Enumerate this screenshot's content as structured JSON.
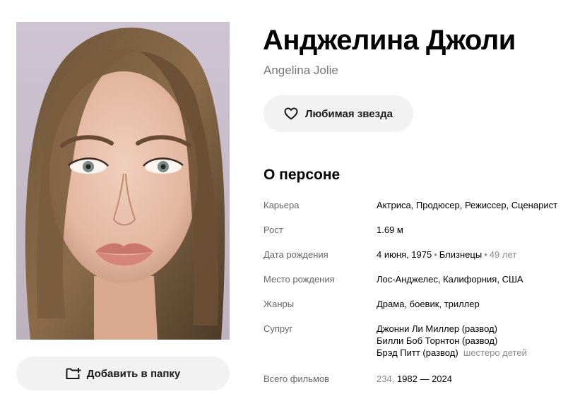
{
  "person": {
    "name_ru": "Анджелина Джоли",
    "name_en": "Angelina Jolie"
  },
  "actions": {
    "favorite_label": "Любимая звезда",
    "add_folder_label": "Добавить в папку"
  },
  "about": {
    "section_title": "О персоне",
    "career": {
      "label": "Карьера",
      "value": "Актриса, Продюсер, Режиссер, Сценарист"
    },
    "height": {
      "label": "Рост",
      "value": "1.69 м"
    },
    "birth_date": {
      "label": "Дата рождения",
      "date": "4 июня, 1975",
      "zodiac": "Близнецы",
      "age": "49 лет"
    },
    "birth_place": {
      "label": "Место рождения",
      "value": "Лос-Анджелес, Калифорния, США"
    },
    "genres": {
      "label": "Жанры",
      "value": "Драма, боевик, триллер"
    },
    "spouses": {
      "label": "Супруг",
      "items": [
        {
          "name": "Джонни Ли Миллер (развод)",
          "note": ""
        },
        {
          "name": "Билли Боб Торнтон (развод)",
          "note": ""
        },
        {
          "name": "Брэд Питт (развод)",
          "note": "шестеро детей"
        }
      ]
    },
    "films_total": {
      "label": "Всего фильмов",
      "count": "234,",
      "years": "1982 — 2024"
    }
  },
  "icons": {
    "favorite": "heart-outline-icon",
    "add_folder": "folder-plus-icon"
  }
}
